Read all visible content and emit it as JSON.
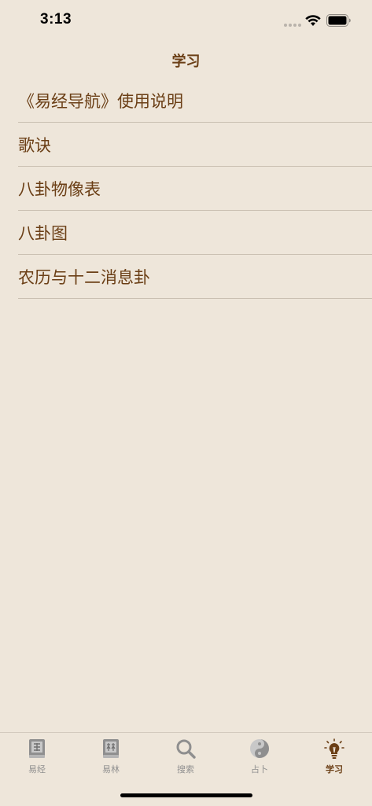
{
  "status_bar": {
    "time": "3:13"
  },
  "nav": {
    "title": "学习"
  },
  "list": {
    "items": [
      "《易经导航》使用说明",
      "歌诀",
      "八卦物像表",
      "八卦图",
      "农历与十二消息卦"
    ]
  },
  "tabs": [
    {
      "label": "易经",
      "icon": "book-jing-icon",
      "active": false
    },
    {
      "label": "易林",
      "icon": "book-lin-icon",
      "active": false
    },
    {
      "label": "搜索",
      "icon": "search-icon",
      "active": false
    },
    {
      "label": "占卜",
      "icon": "yin-yang-icon",
      "active": false
    },
    {
      "label": "学习",
      "icon": "lightbulb-icon",
      "active": true
    }
  ],
  "colors": {
    "background": "#EEE6DA",
    "accent": "#6B3F16",
    "inactive": "#8F8F8F",
    "divider": "#C9BFB1"
  }
}
